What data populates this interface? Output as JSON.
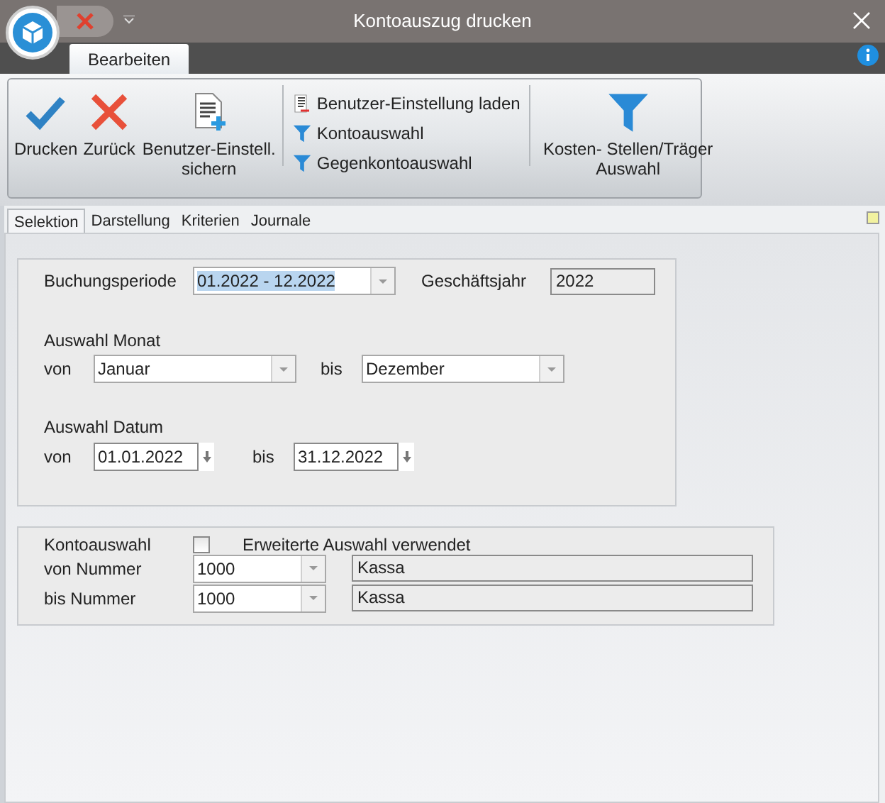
{
  "window": {
    "title": "Kontoauszug drucken"
  },
  "ribbon_tabs": [
    {
      "label": "Bearbeiten",
      "selected": true
    }
  ],
  "ribbon_groups": [
    {
      "items": [
        {
          "kind": "large",
          "label": "Drucken"
        },
        {
          "kind": "large",
          "label": "Zurück"
        },
        {
          "kind": "large",
          "label": "Benutzer-Einstell. sichern"
        }
      ]
    },
    {
      "items": [
        {
          "kind": "small",
          "label": "Benutzer-Einstellung laden"
        },
        {
          "kind": "small",
          "label": "Kontoauswahl"
        },
        {
          "kind": "small",
          "label": "Gegenkontoauswahl"
        }
      ]
    },
    {
      "items": [
        {
          "kind": "large",
          "label": "Kosten- Stellen/Träger Auswahl"
        }
      ]
    }
  ],
  "page_tabs": [
    {
      "label": "Selektion",
      "selected": true
    },
    {
      "label": "Darstellung",
      "selected": false
    },
    {
      "label": "Kriterien",
      "selected": false
    },
    {
      "label": "Journale",
      "selected": false
    }
  ],
  "periode": {
    "label": "Buchungsperiode",
    "value": "01.2022 - 12.2022",
    "text_selected": true,
    "year_label": "Geschäftsjahr",
    "year": "2022"
  },
  "monat": {
    "title": "Auswahl Monat",
    "from_label": "von",
    "from": "Januar",
    "to_label": "bis",
    "to": "Dezember"
  },
  "datum": {
    "title": "Auswahl Datum",
    "from_label": "von",
    "from": "01.01.2022",
    "to_label": "bis",
    "to": "31.12.2022"
  },
  "konto": {
    "label": "Kontoauswahl",
    "extended_checked": false,
    "extended_label": "Erweiterte Auswahl verwendet",
    "rows": [
      {
        "label": "von Nummer",
        "number": "1000",
        "name": "Kassa"
      },
      {
        "label": "bis Nummer",
        "number": "1000",
        "name": "Kassa"
      }
    ]
  }
}
